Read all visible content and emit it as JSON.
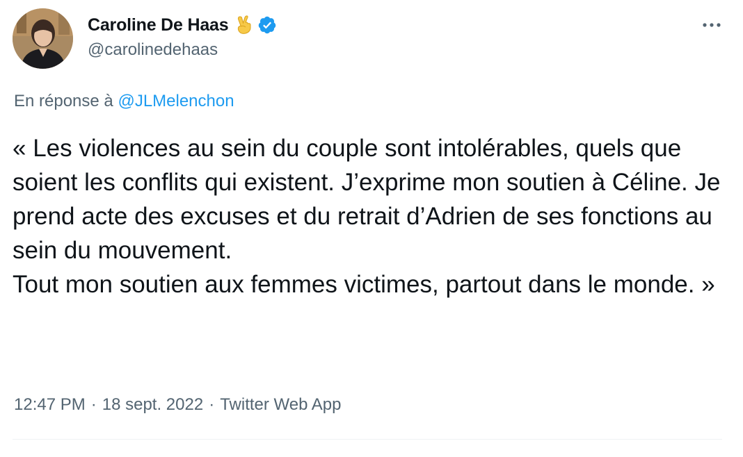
{
  "author": {
    "display_name": "Caroline De Haas",
    "handle": "@carolinedehaas",
    "emoji": "victory-hand-icon",
    "verified": true,
    "verified_color": "#1d9bf0"
  },
  "reply": {
    "prefix": "En réponse à",
    "mention": "@JLMelenchon"
  },
  "tweet": {
    "paragraphs": [
      "« Les violences au sein du couple sont intolérables, quels que soient les conflits qui existent. J’exprime mon soutien à Céline. Je prend acte des excuses et du retrait d’Adrien de ses fonctions au sein du mouvement.",
      "Tout mon soutien aux femmes victimes, partout dans le monde. »"
    ]
  },
  "meta": {
    "time": "12:47 PM",
    "separator": "·",
    "date": "18 sept. 2022",
    "source": "Twitter Web App"
  },
  "colors": {
    "text_primary": "#0f1419",
    "text_secondary": "#536471",
    "link": "#1d9bf0",
    "divider": "#eff3f4"
  }
}
